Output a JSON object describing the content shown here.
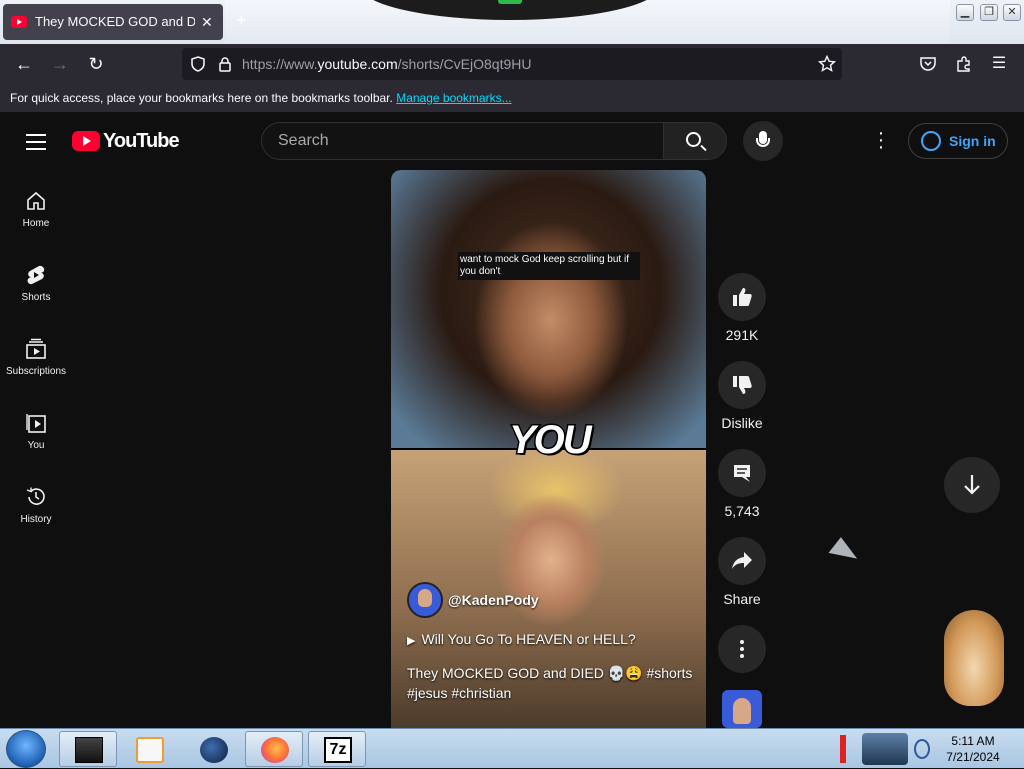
{
  "browser": {
    "tab_title": "They MOCKED GOD and DIED 💀",
    "tab_close": "✕",
    "new_tab": "+",
    "url_prefix": "https://www.",
    "url_domain": "youtube.com",
    "url_path": "/shorts/CvEjO8qt9HU",
    "bookmarks_text": "For quick access, place your bookmarks here on the bookmarks toolbar.",
    "bookmarks_link": "Manage bookmarks..."
  },
  "youtube": {
    "logo_text": "YouTube",
    "search_placeholder": "Search",
    "sign_in": "Sign in",
    "sidebar": [
      {
        "label": "Home"
      },
      {
        "label": "Shorts"
      },
      {
        "label": "Subscriptions"
      },
      {
        "label": "You"
      },
      {
        "label": "History"
      }
    ],
    "short": {
      "caption": "want to mock God keep scrolling but if you don't",
      "overlay_word": "YOU",
      "channel": "@KadenPody",
      "linked_video": "Will You Go To HEAVEN or HELL?",
      "description": "They MOCKED GOD and DIED 💀😩 #shorts #jesus #christian"
    },
    "actions": {
      "likes": "291K",
      "dislike": "Dislike",
      "comments": "5,743",
      "share": "Share"
    }
  },
  "taskbar": {
    "time": "5:11 AM",
    "date": "7/21/2024",
    "sevenzip_label": "7z"
  },
  "colors": {
    "yt_red": "#ff0033",
    "signin_blue": "#3ea6ff",
    "link_cyan": "#00ddff"
  }
}
